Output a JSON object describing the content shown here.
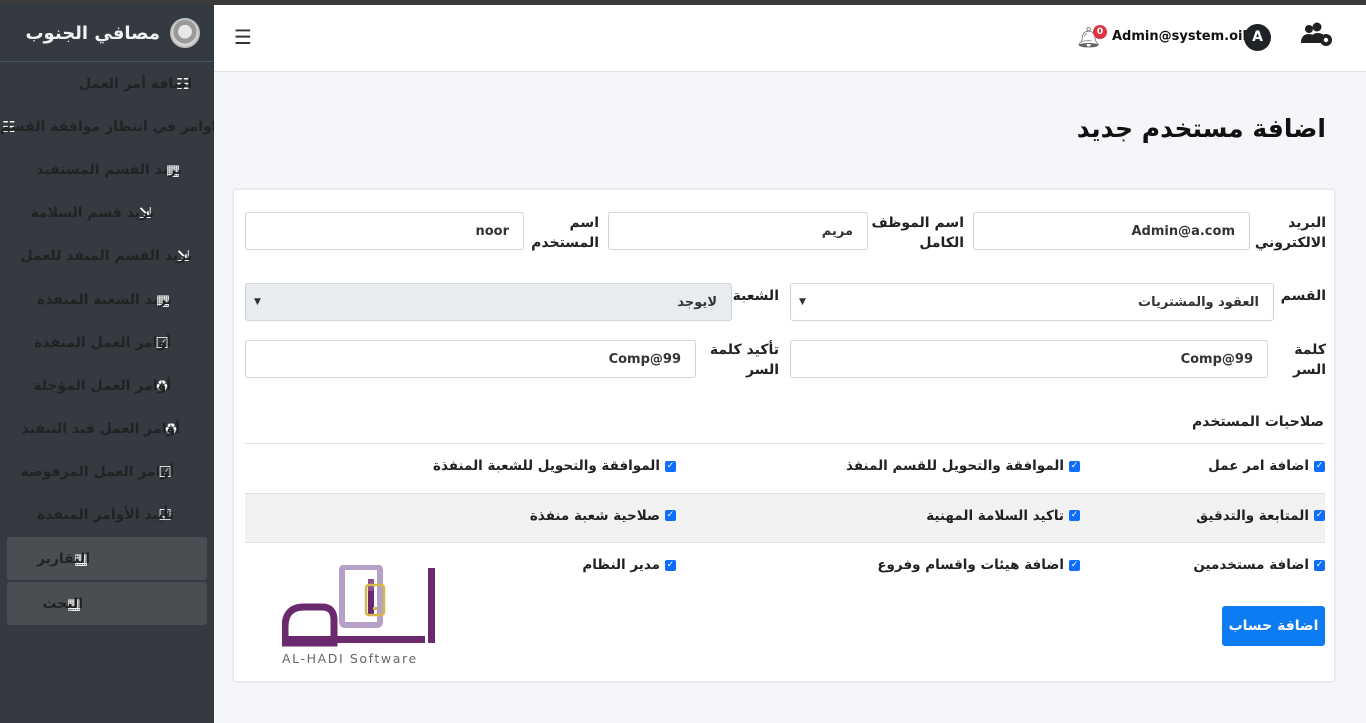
{
  "app": {
    "brand": "مصافي الجنوب"
  },
  "sidebar": {
    "items": [
      {
        "label": "اضافة أمر العمل",
        "icon": "task-list-icon"
      },
      {
        "label": "اوامر في انتظار موافقة القسم",
        "icon": "task-list-icon"
      },
      {
        "label": "بريد القسم المستفيد",
        "icon": "table-icon"
      },
      {
        "label": "بريد قسم السلامة",
        "icon": "file-import-icon"
      },
      {
        "label": "بريد القسم المنفذ للعمل",
        "icon": "file-import-icon"
      },
      {
        "label": "بريد الشعبة المنفذة",
        "icon": "table-icon"
      },
      {
        "label": "أوامر العمل المنفذة",
        "icon": "clipboard-check-icon"
      },
      {
        "label": "أوامر العمل المؤجلة",
        "icon": "recycle-icon"
      },
      {
        "label": "أوامر العمل قيد التنفيذ",
        "icon": "recycle-icon"
      },
      {
        "label": "أوامر العمل المرفوضة",
        "icon": "clipboard-check-icon"
      },
      {
        "label": "تأييد الأوامر المنفذة",
        "icon": "clipboard-check-icon"
      },
      {
        "label": "التقارير",
        "icon": "table-icon"
      },
      {
        "label": "البحث",
        "icon": "table-icon"
      }
    ]
  },
  "header": {
    "menu_icon": "hamburger-icon",
    "notification_count": "0",
    "username": "Admin@system.oil",
    "avatar_letter": "A",
    "settings_icon": "users-gear-icon"
  },
  "page": {
    "title": "اضافة مستخدم جديد"
  },
  "form": {
    "email_label": "البريد الالكتروني",
    "email_value": "Admin@a.com",
    "fullname_label": "اسم الموظف الكامل",
    "fullname_value": "مريم",
    "username_label": "اسم المستخدم",
    "username_value": "noor",
    "department_label": "القسم",
    "department_value": "العقود والمشتريات",
    "branch_label": "الشعبة",
    "branch_value": "لايوجد",
    "password_label": "كلمة السر",
    "password_value": "Comp@99",
    "confirm_label": "تأكيد كلمة السر",
    "confirm_value": "Comp@99",
    "permissions_title": "صلاحيات المستخدم",
    "permissions": [
      [
        "اضافة امر عمل",
        "الموافقة والتحويل للقسم المنفذ",
        "الموافقة والتحويل للشعبة المنفذة"
      ],
      [
        "المتابعة والتدقيق",
        "تاكيد السلامة المهنية",
        "صلاحية شعبة منفذة"
      ],
      [
        "اضافة مستخدمين",
        "اضافة هيئات واقسام وفروع",
        "مدير النظام"
      ]
    ],
    "submit_label": "اضافة حساب"
  },
  "watermark": {
    "caption": "AL-HADI Software"
  },
  "colors": {
    "sidebar": "#343a40",
    "primary": "#0d7bf2",
    "badge": "#dc3545",
    "logo_purple": "#6b2a6e",
    "logo_gold": "#d4b84a"
  }
}
